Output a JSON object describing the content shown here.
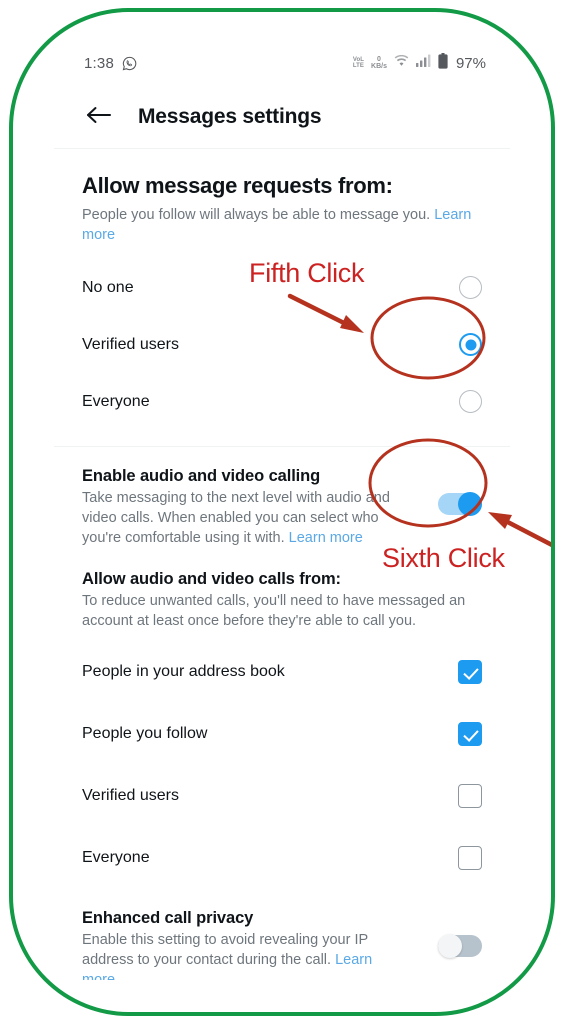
{
  "frame": {
    "border_color": "#129a46"
  },
  "status_bar": {
    "time": "1:38",
    "app_icon": "whatsapp-icon",
    "network_type": "VoLTE",
    "volte_top": "VoL",
    "volte_bottom": "LTE",
    "data_rate_value": "0",
    "data_rate_unit": "KB/s",
    "wifi_icon": "wifi-icon",
    "signal_icon": "cellular-signal-icon",
    "battery_icon": "battery-icon",
    "battery_percent": "97%"
  },
  "appbar": {
    "back_icon": "back-arrow-icon",
    "title": "Messages settings"
  },
  "message_requests": {
    "heading": "Allow message requests from:",
    "description": "People you follow will always be able to message you. ",
    "learn_more": "Learn more",
    "options": [
      {
        "label": "No one",
        "checked": false
      },
      {
        "label": "Verified users",
        "checked": true
      },
      {
        "label": "Everyone",
        "checked": false
      }
    ]
  },
  "audio_video_calling": {
    "title": "Enable audio and video calling",
    "description": "Take messaging to the next level with audio and video calls. When enabled you can select who you're comfortable using it with. ",
    "learn_more": "Learn more",
    "toggle_state": "on"
  },
  "calls_from": {
    "heading": "Allow audio and video calls from:",
    "description": "To reduce unwanted calls, you'll need to have messaged an account at least once before they're able to call you.",
    "options": [
      {
        "label": "People in your address book",
        "checked": true
      },
      {
        "label": "People you follow",
        "checked": true
      },
      {
        "label": "Verified users",
        "checked": false
      },
      {
        "label": "Everyone",
        "checked": false
      }
    ]
  },
  "enhanced_call_privacy": {
    "title": "Enhanced call privacy",
    "description": "Enable this setting to avoid revealing your IP address to your contact during the call. ",
    "learn_more": "Learn more",
    "toggle_state": "off"
  },
  "annotations": {
    "color": "#cc2222",
    "items": [
      {
        "label": "Fifth Click",
        "target": "verified-users-radio"
      },
      {
        "label": "Sixth Click",
        "target": "audio-video-calling-toggle"
      }
    ]
  },
  "colors": {
    "accent_blue": "#1d9bf0",
    "link_blue": "#5aa9e6",
    "text_primary": "#0f1419",
    "text_secondary": "#6e767d",
    "annotation_red": "#cc2222",
    "frame_green": "#129a46"
  }
}
